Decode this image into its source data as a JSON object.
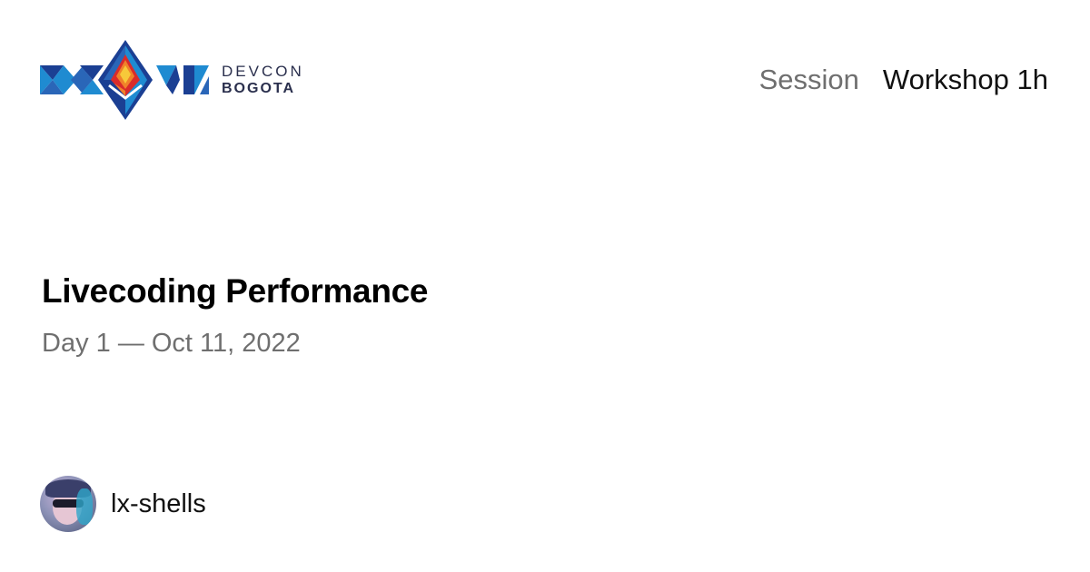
{
  "brand": {
    "logo_icon": "devcon-bogota-logo-icon",
    "line1": "DEVCON",
    "line2": "BOGOTA",
    "colors": {
      "blue_dark": "#1b3f93",
      "blue_light": "#1f8bd1",
      "red": "#d92b2b",
      "orange": "#f0822a",
      "yellow": "#f7c93a"
    }
  },
  "session": {
    "type": "Session",
    "format": "Workshop 1h",
    "title": "Livecoding Performance",
    "date_line": "Day 1 — Oct 11, 2022"
  },
  "speaker": {
    "avatar_icon": "speaker-avatar",
    "name": "lx-shells"
  }
}
